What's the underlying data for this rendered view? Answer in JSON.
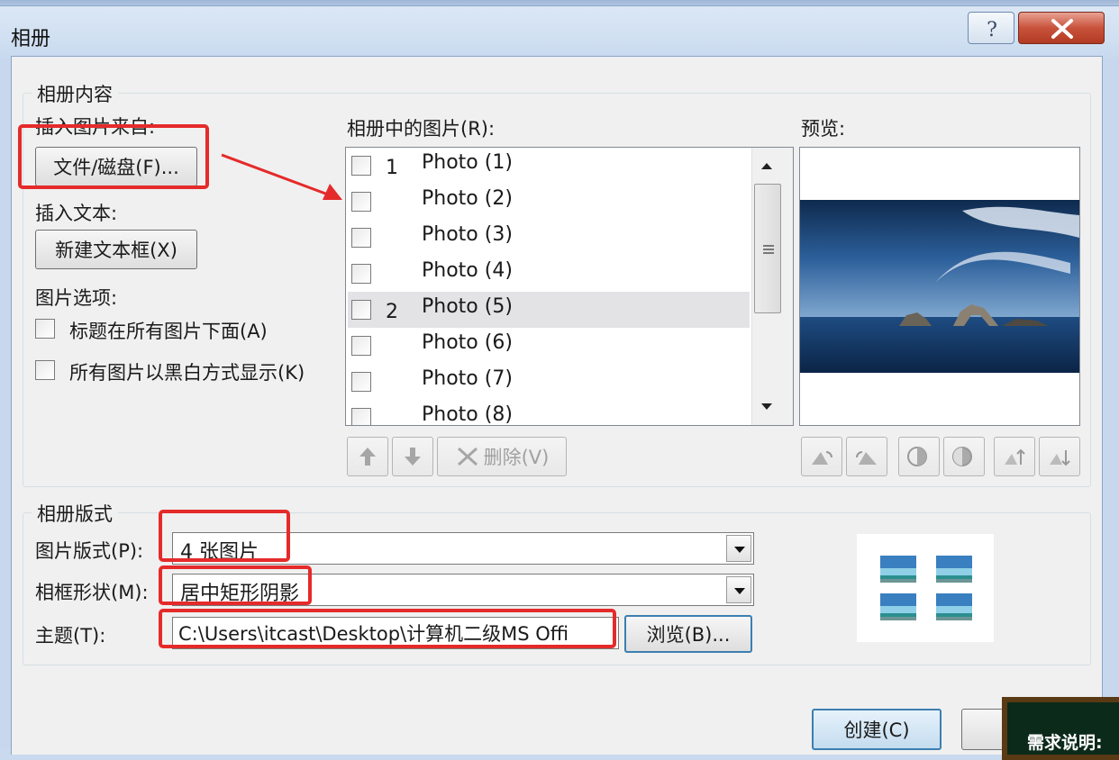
{
  "window": {
    "title": "相册",
    "help_glyph": "?",
    "close_glyph": "X"
  },
  "album_content": {
    "group_label": "相册内容",
    "insert_from_label": "插入图片来自:",
    "file_disk_button": "文件/磁盘(F)...",
    "insert_text_label": "插入文本:",
    "new_textbox_button": "新建文本框(X)",
    "picture_options_label": "图片选项:",
    "captions_below_label": "标题在所有图片下面(A)",
    "black_white_label": "所有图片以黑白方式显示(K)",
    "pictures_in_album_label": "相册中的图片(R):",
    "photos": [
      {
        "num": "1",
        "name": "Photo (1)"
      },
      {
        "num": "",
        "name": "Photo (2)"
      },
      {
        "num": "",
        "name": "Photo (3)"
      },
      {
        "num": "",
        "name": "Photo (4)"
      },
      {
        "num": "2",
        "name": "Photo (5)"
      },
      {
        "num": "",
        "name": "Photo (6)"
      },
      {
        "num": "",
        "name": "Photo (7)"
      },
      {
        "num": "",
        "name": "Photo (8)"
      }
    ],
    "selected_photo": "Photo (5)",
    "delete_button": "删除(V)",
    "preview_label": "预览:"
  },
  "album_layout": {
    "group_label": "相册版式",
    "picture_layout_label": "图片版式(P):",
    "picture_layout_value": "4 张图片",
    "frame_shape_label": "相框形状(M):",
    "frame_shape_value": "居中矩形阴影",
    "theme_label": "主题(T):",
    "theme_value": "C:\\Users\\itcast\\Desktop\\计算机二级MS Offi",
    "browse_button": "浏览(B)..."
  },
  "footer": {
    "create_button": "创建(C)"
  },
  "overlay_note": {
    "text": "需求说明:"
  },
  "colors": {
    "highlight_red": "#e52a2a",
    "titlebar": "#cfdff1",
    "close_red": "#c8533c"
  }
}
